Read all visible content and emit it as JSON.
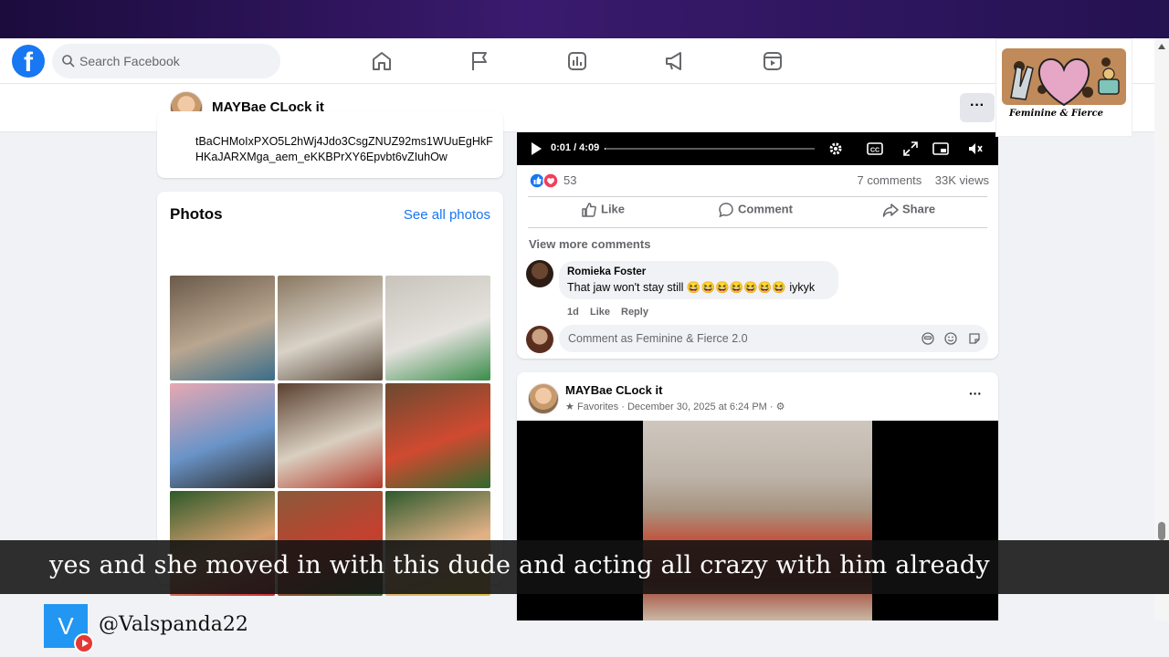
{
  "search": {
    "placeholder": "Search Facebook"
  },
  "nav": {
    "icons": [
      "home-icon",
      "flag-icon",
      "chart-icon",
      "megaphone-icon",
      "video-icon"
    ]
  },
  "profile": {
    "name": "MAYBae CLock it"
  },
  "intro": {
    "text": "tBaCHMoIxPXO5L2hWj4Jdo3CsgZNUZ92ms1WUuEgHkFHKaJARXMga_aem_eKKBPrXY6Epvbt6vZIuhOw"
  },
  "photos": {
    "title": "Photos",
    "see_all": "See all photos",
    "items": [
      {
        "colors": [
          "#6b5a4a",
          "#b9a690",
          "#3a6d8a"
        ]
      },
      {
        "colors": [
          "#8a7860",
          "#d8d2c8",
          "#5a4a3a"
        ]
      },
      {
        "colors": [
          "#c8c4bc",
          "#e5e2de",
          "#3a8c4a"
        ]
      },
      {
        "colors": [
          "#e7a8b2",
          "#6a94c8",
          "#2c2c2c"
        ]
      },
      {
        "colors": [
          "#5a4030",
          "#d9cfc0",
          "#b33a2a"
        ]
      },
      {
        "colors": [
          "#6a4a30",
          "#d04a30",
          "#2e6a2e"
        ]
      },
      {
        "colors": [
          "#2f5a2a",
          "#d7a070",
          "#c9323a"
        ]
      },
      {
        "colors": [
          "#8a5a3a",
          "#c5402e",
          "#3c6a3a"
        ]
      },
      {
        "colors": [
          "#2e5a2e",
          "#e1b085",
          "#d8c04a"
        ]
      }
    ]
  },
  "video": {
    "time": "0:01 / 4:09",
    "progress_percent": 0.4
  },
  "post": {
    "reaction_count": "53",
    "comments": "7 comments",
    "views": "33K views",
    "actions": {
      "like": "Like",
      "comment": "Comment",
      "share": "Share"
    },
    "view_more": "View more comments",
    "comment": {
      "author": "Romieka Foster",
      "text": "That jaw won't stay still 😆😆😆😆😆😆😆 iykyk",
      "time": "1d",
      "like": "Like",
      "reply": "Reply"
    },
    "composer_placeholder": "Comment as Feminine & Fierce 2.0"
  },
  "post2": {
    "author": "MAYBae CLock it",
    "meta": "Favorites · December 30, 2025 at 6:24 PM ·",
    "more": "···"
  },
  "overlay": {
    "logo_text": "Feminine & Fierce",
    "caption": "yes and she moved in with this dude and acting all crazy with him already",
    "channel_initial": "V",
    "channel_handle": "@Valspanda22"
  },
  "colors": {
    "facebook_blue": "#1877f2",
    "like_blue": "#1877f2",
    "love_red": "#f33e58"
  }
}
